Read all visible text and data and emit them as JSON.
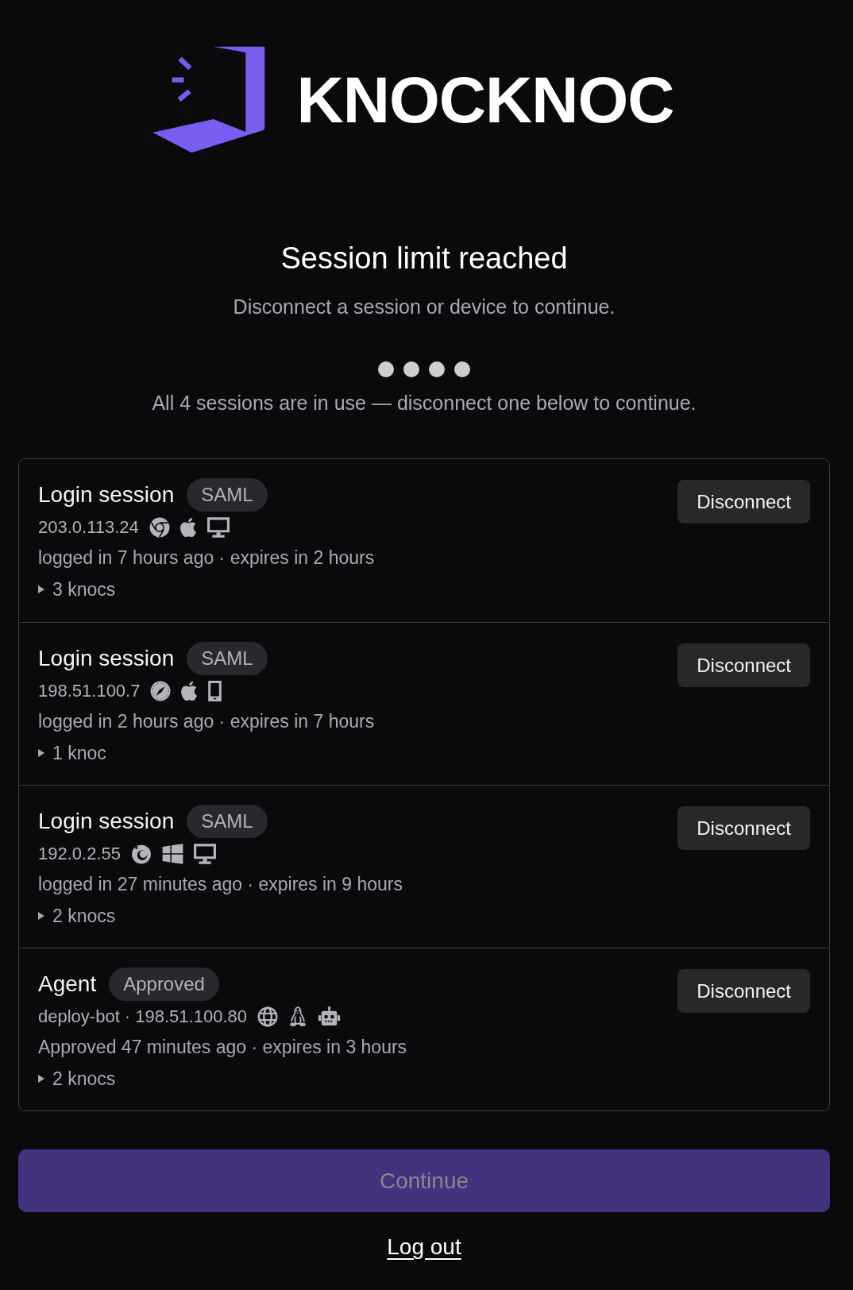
{
  "logo": {
    "name": "KNOCKNOC"
  },
  "heading": {
    "title": "Session limit reached",
    "subtitle": "Disconnect a session or device to continue."
  },
  "usage": {
    "slots": [
      {
        "used": true
      },
      {
        "used": true
      },
      {
        "used": true
      },
      {
        "used": true
      }
    ],
    "message": "All 4 sessions are in use — disconnect one below to continue."
  },
  "sessions": [
    {
      "title": "Login session",
      "badge": "SAML",
      "address": "203.0.113.24",
      "icons": [
        {
          "kind": "chrome"
        },
        {
          "kind": "apple"
        },
        {
          "kind": "desktop"
        }
      ],
      "times": "logged in 7 hours ago · expires in 2 hours",
      "knocs": {
        "label": "3 knocs",
        "expanded": false
      },
      "action": "Disconnect"
    },
    {
      "title": "Login session",
      "badge": "SAML",
      "address": "198.51.100.7",
      "icons": [
        {
          "kind": "safari"
        },
        {
          "kind": "apple"
        },
        {
          "kind": "phone"
        }
      ],
      "times": "logged in 2 hours ago · expires in 7 hours",
      "knocs": {
        "label": "1 knoc",
        "expanded": false
      },
      "action": "Disconnect"
    },
    {
      "title": "Login session",
      "badge": "SAML",
      "address": "192.0.2.55",
      "icons": [
        {
          "kind": "firefox"
        },
        {
          "kind": "windows"
        },
        {
          "kind": "desktop"
        }
      ],
      "times": "logged in 27 minutes ago · expires in 9 hours",
      "knocs": {
        "label": "2 knocs",
        "expanded": false
      },
      "action": "Disconnect"
    },
    {
      "title": "Agent",
      "badge": "Approved",
      "address": "deploy-bot · 198.51.100.80",
      "icons": [
        {
          "kind": "globe"
        },
        {
          "kind": "linux"
        },
        {
          "kind": "robot"
        }
      ],
      "times": "Approved 47 minutes ago · expires in 3 hours",
      "knocs": {
        "label": "2 knocs",
        "expanded": false
      },
      "action": "Disconnect"
    }
  ],
  "continue_button": {
    "label": "Continue",
    "disabled": true
  },
  "logout_link": "Log out"
}
